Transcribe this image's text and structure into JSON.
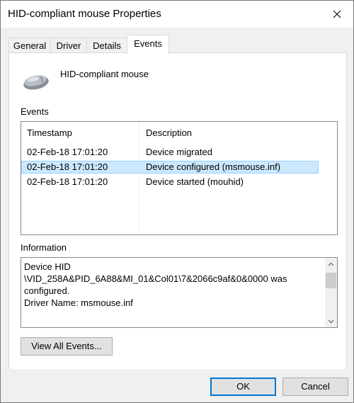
{
  "window": {
    "title": "HID-compliant mouse Properties"
  },
  "tabs": [
    {
      "label": "General"
    },
    {
      "label": "Driver"
    },
    {
      "label": "Details"
    },
    {
      "label": "Events",
      "active": true
    }
  ],
  "device": {
    "name": "HID-compliant mouse",
    "icon": "mouse-icon"
  },
  "events": {
    "section_label": "Events",
    "columns": [
      "Timestamp",
      "Description"
    ],
    "rows": [
      {
        "timestamp": "02-Feb-18 17:01:20",
        "description": "Device migrated"
      },
      {
        "timestamp": "02-Feb-18 17:01:20",
        "description": "Device configured (msmouse.inf)",
        "selected": true
      },
      {
        "timestamp": "02-Feb-18 17:01:20",
        "description": "Device started (mouhid)"
      }
    ]
  },
  "information": {
    "section_label": "Information",
    "lines": [
      "Device HID",
      "\\VID_258A&PID_6A88&MI_01&Col01\\7&2066c9af&0&0000 was configured.",
      "",
      "Driver Name: msmouse.inf"
    ]
  },
  "buttons": {
    "view_all": "View All Events...",
    "ok": "OK",
    "cancel": "Cancel"
  },
  "colors": {
    "selection_bg": "#cce8ff",
    "selection_border": "#99d1ff",
    "default_button_border": "#0078d7"
  }
}
